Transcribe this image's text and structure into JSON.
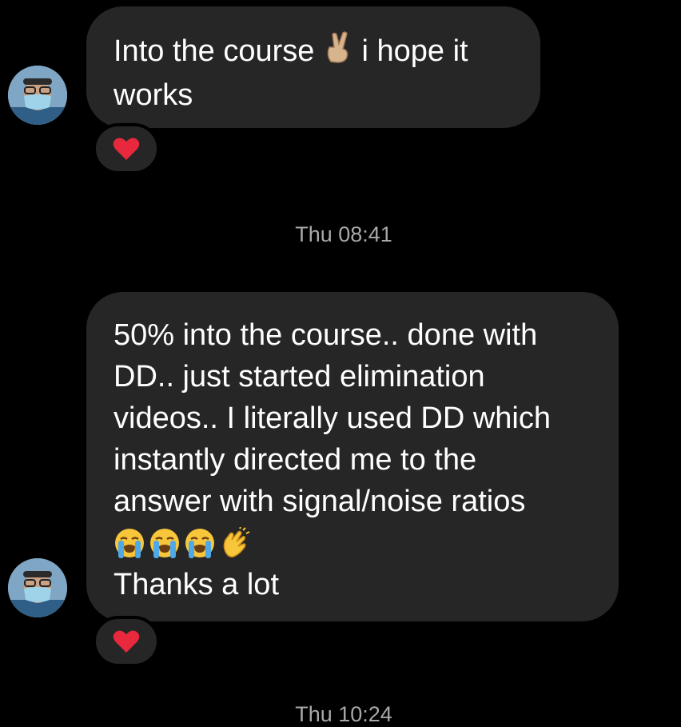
{
  "messages": [
    {
      "lines": [
        "Into the course",
        "i hope it",
        "works"
      ],
      "emoji_after_first": "crossed-fingers-emoji",
      "reaction": "heart"
    },
    {
      "lines": [
        "50% into the course.. done with",
        "DD.. just started elimination",
        "videos.. I literally used DD which",
        "instantly directed me to the",
        "answer with signal/noise ratios",
        "Thanks a lot"
      ],
      "emoji_line": [
        "loudly-crying-emoji",
        "loudly-crying-emoji",
        "loudly-crying-emoji",
        "clapping-hands-emoji"
      ],
      "reaction": "heart"
    }
  ],
  "timestamps": {
    "first": "Thu 08:41",
    "second": "Thu 10:24"
  },
  "colors": {
    "background": "#000000",
    "bubble": "#262626",
    "text": "#ffffff",
    "timestamp": "#a8a8a8",
    "heart": "#e8283c"
  }
}
